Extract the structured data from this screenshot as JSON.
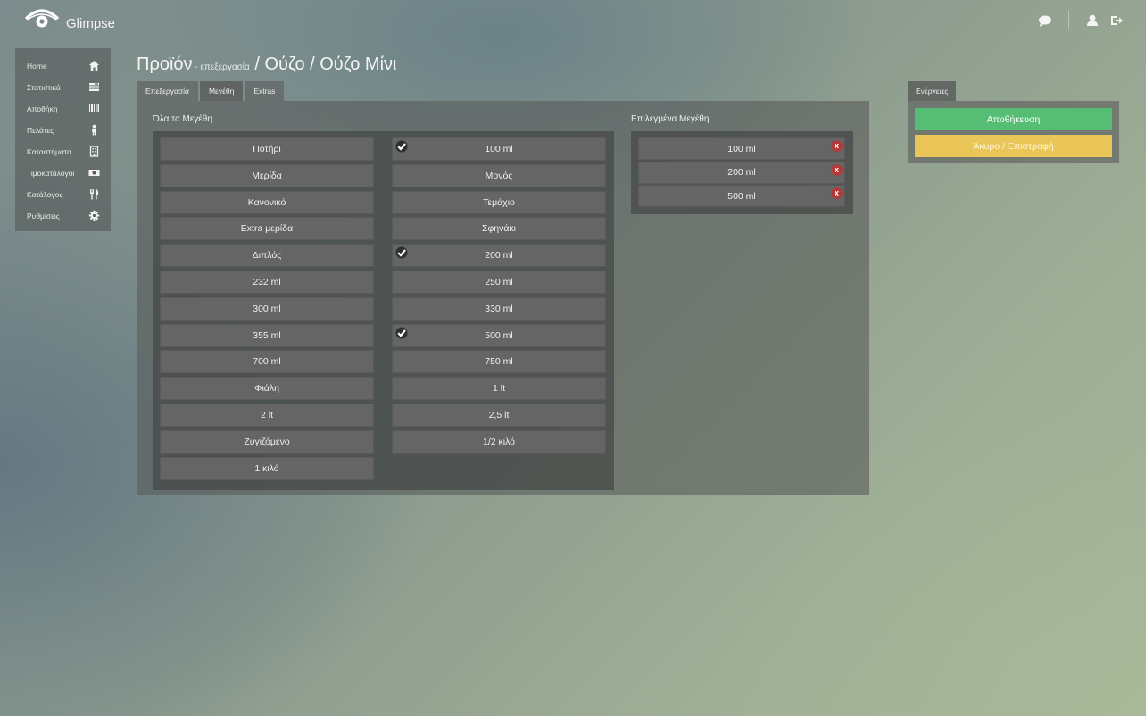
{
  "app": {
    "brand": "Glimpse",
    "logo_icon": "eye-icon"
  },
  "topbar": {
    "icons": [
      "comment-icon",
      "user-icon",
      "logout-icon"
    ]
  },
  "sidebar": {
    "items": [
      {
        "label": "Home",
        "icon": "home-icon"
      },
      {
        "label": "Στατιστικά",
        "icon": "stats-icon"
      },
      {
        "label": "Αποθήκη",
        "icon": "barcode-icon"
      },
      {
        "label": "Πελάτες",
        "icon": "person-icon"
      },
      {
        "label": "Καταστήματα",
        "icon": "building-icon"
      },
      {
        "label": "Τιμοκατάλογοι",
        "icon": "money-icon"
      },
      {
        "label": "Κατάλογος",
        "icon": "cutlery-icon"
      },
      {
        "label": "Ρυθμίσεις",
        "icon": "gear-icon"
      }
    ]
  },
  "header": {
    "title_main": "Προϊόν",
    "title_sub": " - επεξεργασία",
    "title_path": " / Ούζο / Ούζο Μίνι"
  },
  "tabs": [
    {
      "label": "Επεξεργασία"
    },
    {
      "label": "Μεγέθη",
      "active": true
    },
    {
      "label": "Extras"
    }
  ],
  "sizes": {
    "all_label": "Όλα τα Μεγέθη",
    "selected_label": "Επιλεγμένα Μεγέθη",
    "column1": [
      "Ποτήρι",
      "Μερίδα",
      "Κανονικό",
      "Extra μερίδα",
      "Διπλός",
      "232 ml",
      "300 ml",
      "355 ml",
      "700 ml",
      "Φιάλη",
      "2 lt",
      "Ζυγιζόμενο",
      "1 κιλό"
    ],
    "column2": [
      {
        "label": "100 ml",
        "checked": true
      },
      {
        "label": "Μονός",
        "checked": false
      },
      {
        "label": "Τεμάχιο",
        "checked": false
      },
      {
        "label": "Σφηνάκι",
        "checked": false
      },
      {
        "label": "200 ml",
        "checked": true
      },
      {
        "label": "250 ml",
        "checked": false
      },
      {
        "label": "330 ml",
        "checked": false
      },
      {
        "label": "500 ml",
        "checked": true
      },
      {
        "label": "750 ml",
        "checked": false
      },
      {
        "label": "1 lt",
        "checked": false
      },
      {
        "label": "2,5 lt",
        "checked": false
      },
      {
        "label": "1/2 κιλό",
        "checked": false
      }
    ],
    "selected": [
      "100 ml",
      "200 ml",
      "500 ml"
    ],
    "remove_label": "x"
  },
  "actions": {
    "tab_label": "Ενέργειες",
    "save_label": "Αποθήκευση",
    "cancel_label": "Άκυρο / Επιστροφή"
  },
  "colors": {
    "save": "#55bd74",
    "cancel": "#e9c657",
    "remove": "#b23a3a"
  }
}
